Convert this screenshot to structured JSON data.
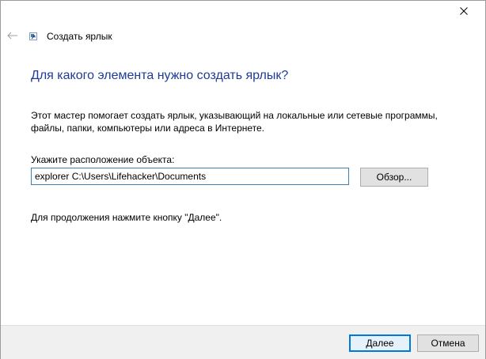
{
  "window": {
    "title": "Создать ярлык",
    "close_icon": "close-icon",
    "back_icon": "back-arrow-icon",
    "app_icon": "shortcut-icon"
  },
  "main": {
    "heading": "Для какого элемента нужно создать ярлык?",
    "description": "Этот мастер помогает создать ярлык, указывающий на локальные или сетевые программы, файлы, папки, компьютеры или адреса в Интернете.",
    "location_label": "Укажите расположение объекта:",
    "location_value": "explorer C:\\Users\\Lifehacker\\Documents",
    "browse_label": "Обзор...",
    "continue_hint": "Для продолжения нажмите кнопку \"Далее\"."
  },
  "footer": {
    "next_label": "Далее",
    "cancel_label": "Отмена"
  },
  "colors": {
    "heading": "#1e3c96",
    "input_border": "#3c7fb1",
    "accent": "#0078d7",
    "footer_bg": "#f0f0f0",
    "button_bg": "#e1e1e1"
  }
}
